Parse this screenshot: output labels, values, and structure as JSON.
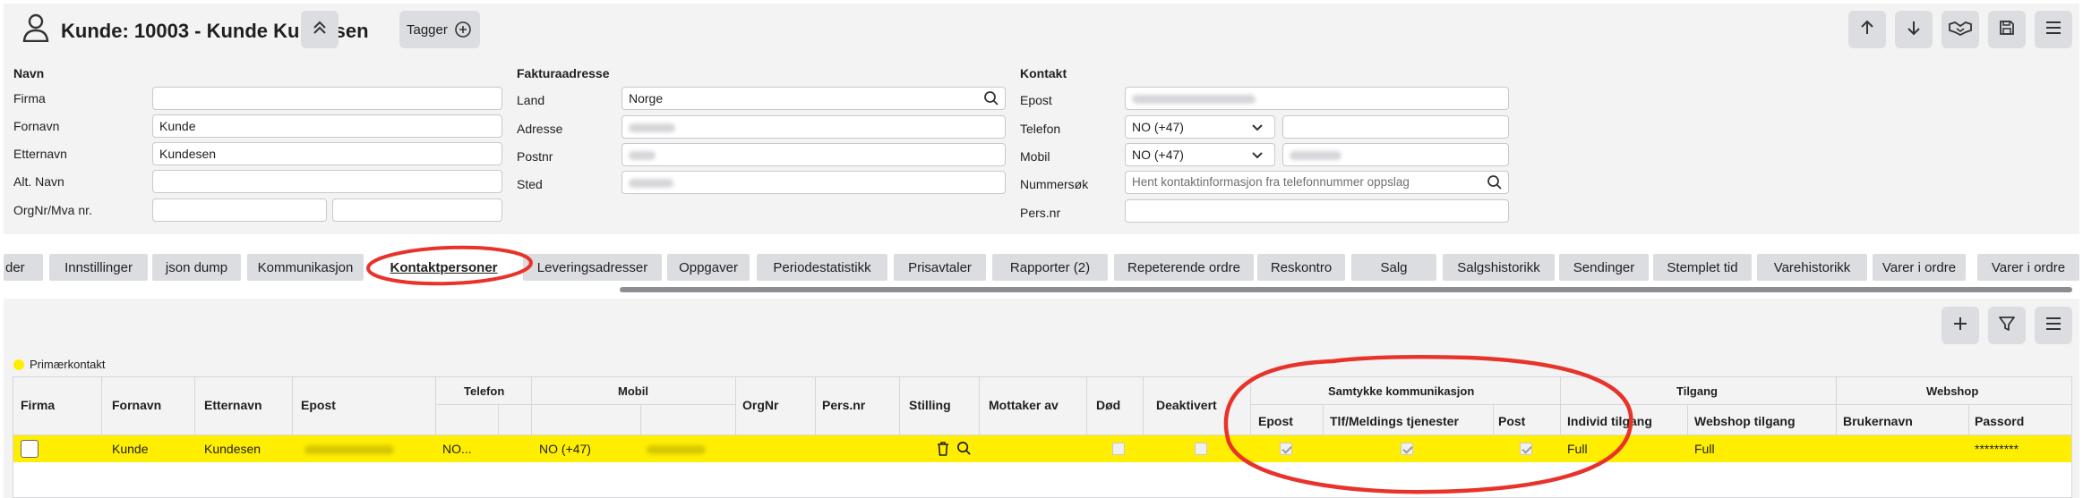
{
  "header": {
    "title": "Kunde: 10003 - Kunde Kundesen",
    "tags_label": "Tagger"
  },
  "navn": {
    "heading": "Navn",
    "firma_label": "Firma",
    "fornavn_label": "Fornavn",
    "fornavn_value": "Kunde",
    "etternavn_label": "Etternavn",
    "etternavn_value": "Kundesen",
    "altnavn_label": "Alt. Navn",
    "orgnr_label": "OrgNr/Mva nr."
  },
  "faktura": {
    "heading": "Fakturaadresse",
    "land_label": "Land",
    "land_value": "Norge",
    "adresse_label": "Adresse",
    "postnr_label": "Postnr",
    "sted_label": "Sted"
  },
  "kontakt": {
    "heading": "Kontakt",
    "epost_label": "Epost",
    "telefon_label": "Telefon",
    "telefon_code": "NO (+47)",
    "mobil_label": "Mobil",
    "mobil_code": "NO (+47)",
    "nummersok_label": "Nummersøk",
    "nummersok_placeholder": "Hent kontaktinformasjon fra telefonnummer oppslag",
    "persnr_label": "Pers.nr"
  },
  "tabs": [
    "der",
    "Innstillinger",
    "json dump",
    "Kommunikasjon",
    "Kontaktpersoner",
    "Leveringsadresser",
    "Oppgaver",
    "Periodestatistikk",
    "Prisavtaler",
    "Rapporter (2)",
    "Repeterende ordre",
    "Reskontro",
    "Salg",
    "Salgshistorikk",
    "Sendinger",
    "Stemplet tid",
    "Varehistorikk",
    "Varer i ordre",
    "Varer i ordre"
  ],
  "active_tab": "Kontaktpersoner",
  "legend": {
    "primary": "Primærkontakt"
  },
  "table": {
    "group_headers": {
      "telefon": "Telefon",
      "mobil": "Mobil",
      "samtykke": "Samtykke kommunikasjon",
      "tilgang": "Tilgang",
      "webshop": "Webshop"
    },
    "headers": {
      "firma": "Firma",
      "fornavn": "Fornavn",
      "etternavn": "Etternavn",
      "epost": "Epost",
      "orgnr": "OrgNr",
      "persnr": "Pers.nr",
      "stilling": "Stilling",
      "mottaker": "Mottaker av",
      "dod": "Død",
      "deaktivert": "Deaktivert",
      "samtykke_epost": "Epost",
      "samtykke_tlf": "Tlf/Meldings tjenester",
      "samtykke_post": "Post",
      "individ": "Individ tilgang",
      "webshop_tilgang": "Webshop tilgang",
      "brukernavn": "Brukernavn",
      "passord": "Passord"
    },
    "row": {
      "fornavn": "Kunde",
      "etternavn": "Kundesen",
      "telefon": "NO...",
      "mobil": "NO (+47)",
      "individ": "Full",
      "webshop_tilgang": "Full",
      "passord": "*********",
      "samtykke_epost": true,
      "samtykke_tlf": true,
      "samtykke_post": true
    }
  },
  "colors": {
    "accent_row": "#ffee00",
    "annotation": "#e8322a",
    "panel": "#f3f3f4"
  }
}
